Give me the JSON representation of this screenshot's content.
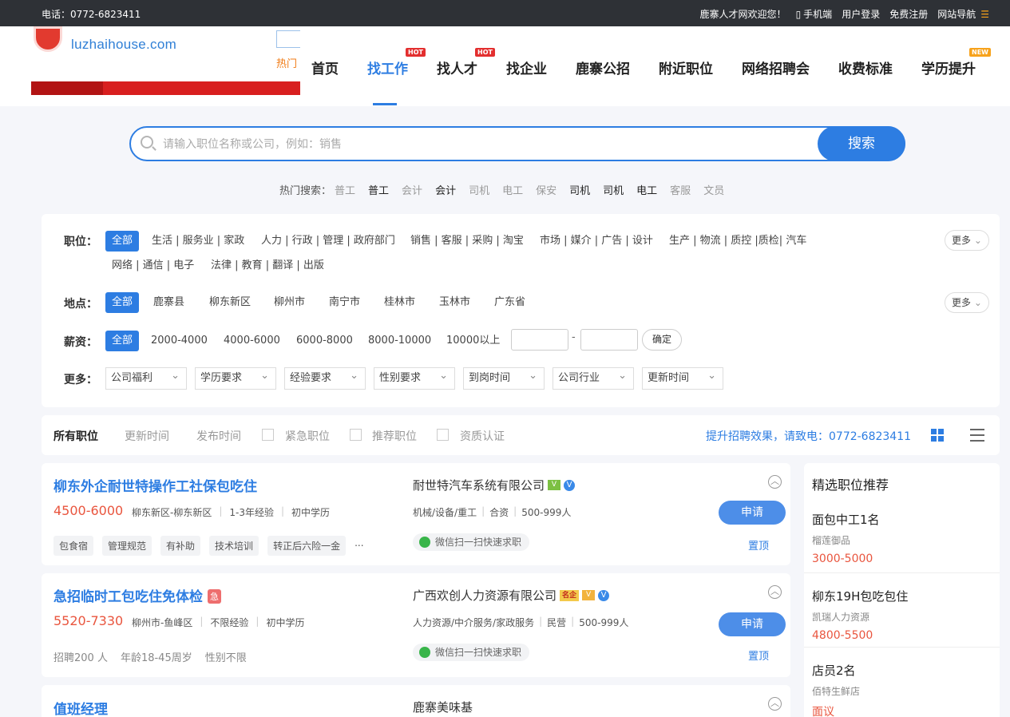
{
  "topbar": {
    "phone": "电话：0772-6823411",
    "welcome": "鹿寨人才网欢迎您！",
    "mobile": "手机端",
    "login": "用户登录",
    "register": "免费注册",
    "sitenav": "网站导航"
  },
  "logo": {
    "text": "luzhaihouse.com"
  },
  "header": {
    "hot_side": "热门"
  },
  "nav": {
    "items": [
      {
        "label": "首页"
      },
      {
        "label": "找工作",
        "badge": "HOT"
      },
      {
        "label": "找人才",
        "badge": "HOT"
      },
      {
        "label": "找企业"
      },
      {
        "label": "鹿寨公招"
      },
      {
        "label": "附近职位"
      },
      {
        "label": "网络招聘会"
      },
      {
        "label": "收费标准"
      },
      {
        "label": "学历提升",
        "badge": "NEW"
      }
    ]
  },
  "search": {
    "placeholder": "请输入职位名称或公司，例如：销售",
    "button": "搜索"
  },
  "hot": {
    "label": "热门搜索：",
    "keywords": [
      "普工",
      "普工",
      "会计",
      "会计",
      "司机",
      "电工",
      "保安",
      "司机",
      "司机",
      "电工",
      "客服",
      "文员"
    ]
  },
  "filter": {
    "position_label": "职位：",
    "all": "全部",
    "positions": [
      "生活 | 服务业 | 家政",
      "人力 | 行政 | 管理 | 政府部门",
      "销售 | 客服 | 采购 | 淘宝",
      "市场 | 媒介 | 广告 | 设计",
      "生产 | 物流 | 质控 |质检| 汽车",
      "网络 | 通信 | 电子",
      "法律 | 教育 | 翻译 | 出版"
    ],
    "more": "更多",
    "location_label": "地点：",
    "locations": [
      "鹿寨县",
      "柳东新区",
      "柳州市",
      "南宁市",
      "桂林市",
      "玉林市",
      "广东省"
    ],
    "salary_label": "薪资：",
    "salaries": [
      "2000-4000",
      "4000-6000",
      "6000-8000",
      "8000-10000",
      "10000以上"
    ],
    "dash": "-",
    "confirm": "确定",
    "more_label": "更多：",
    "selects": [
      "公司福利",
      "学历要求",
      "经验要求",
      "性别要求",
      "到岗时间",
      "公司行业",
      "更新时间"
    ]
  },
  "sortbar": {
    "all": "所有职位",
    "update": "更新时间",
    "publish": "发布时间",
    "urgent": "紧急职位",
    "recommend": "推荐职位",
    "certified": "资质认证",
    "promo": "提升招聘效果，请致电：0772-6823411"
  },
  "jobs": [
    {
      "title": "柳东外企耐世特操作工社保包吃住",
      "salary": "4500-6000",
      "location": "柳东新区-柳东新区",
      "experience": "1-3年经验",
      "education": "初中学历",
      "tags": [
        "包食宿",
        "管理规范",
        "有补助",
        "技术培训",
        "转正后六险一金"
      ],
      "tags_more": "...",
      "company": "耐世特汽车系统有限公司",
      "industry": "机械/设备/重工",
      "nature": "合资",
      "size": "500-999人",
      "wechat": "微信扫一扫快速求职",
      "apply": "申请",
      "top": "置顶"
    },
    {
      "title": "急招临时工包吃住免体检",
      "urgent": "急",
      "salary": "5520-7330",
      "location": "柳州市-鱼峰区",
      "experience": "不限经验",
      "education": "初中学历",
      "plain": [
        "招聘200 人",
        "年龄18-45周岁",
        "性别不限"
      ],
      "company": "广西欢创人力资源有限公司",
      "famous": "名企",
      "industry": "人力资源/中介服务/家政服务",
      "nature": "民营",
      "size": "500-999人",
      "wechat": "微信扫一扫快速求职",
      "apply": "申请",
      "top": "置顶"
    },
    {
      "title": "值班经理",
      "company": "鹿寨美味基"
    }
  ],
  "sidebar": {
    "title": "精选职位推荐",
    "items": [
      {
        "title": "面包中工1名",
        "company": "榴莲御品",
        "salary": "3000-5000"
      },
      {
        "title": "柳东19H包吃包住",
        "company": "凯瑞人力资源",
        "salary": "4800-5500"
      },
      {
        "title": "店员2名",
        "company": "佰特生鲜店",
        "salary": "面议"
      }
    ]
  },
  "colors": {
    "accent": "#2d7de2",
    "salary": "#e9553e",
    "topbar": "#2e3136"
  }
}
